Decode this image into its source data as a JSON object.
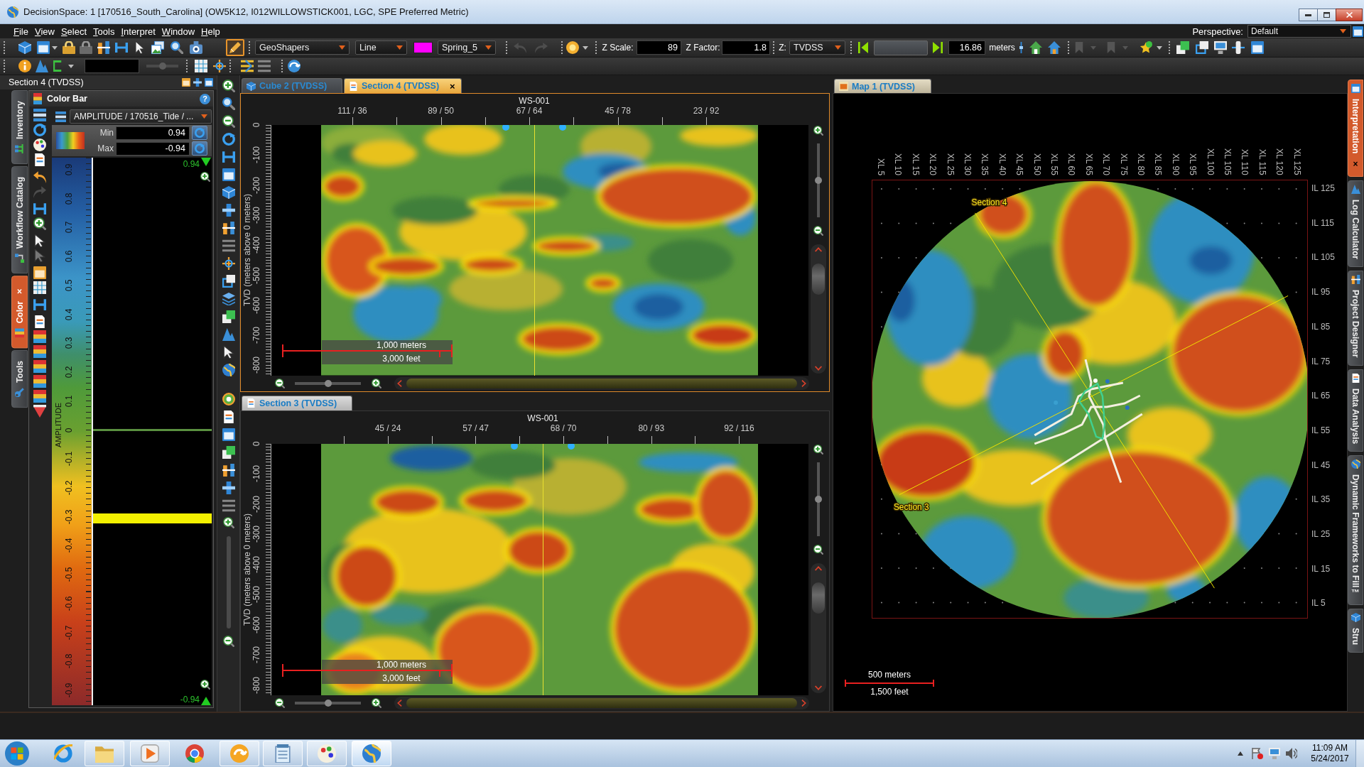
{
  "window": {
    "title": "DecisionSpace: 1 [170516_South_Carolina] (OW5K12, I012WILLOWSTICK001, LGC, SPE Preferred Metric)"
  },
  "menu": [
    "File",
    "View",
    "Select",
    "Tools",
    "Interpret",
    "Window",
    "Help"
  ],
  "perspective": {
    "label": "Perspective:",
    "value": "Default"
  },
  "toolbar": {
    "draw_mode_on": true,
    "shape_set": "GeoShapers",
    "shape_style": "Line",
    "color_map": "Spring_5",
    "undo_disabled": true,
    "redo_disabled": true,
    "z_scale_label": "Z Scale:",
    "z_scale": "89",
    "z_factor_label": "Z Factor:",
    "z_factor": "1.8",
    "z_label": "Z:",
    "z_domain": "TVDSS",
    "step": "16.86",
    "step_unit": "meters",
    "bookmarks_disabled": true
  },
  "toolbar_2": {
    "slider": {
      "level": 0.5,
      "disabled": true
    }
  },
  "left_panel": {
    "title": "Section 4 (TVDSS)",
    "tabs": [
      {
        "label": "Inventory",
        "selected": false
      },
      {
        "label": "Workflow Catalog",
        "selected": false
      },
      {
        "label": "Color",
        "selected": true,
        "close": "×"
      },
      {
        "label": "Tools",
        "selected": false
      }
    ],
    "color_bar": {
      "title": "Color Bar",
      "help": "?",
      "attribute": "AMPLITUDE / 170516_Tide / ...",
      "min_label": "Min",
      "min": "0.94",
      "max_label": "Max",
      "max": "-0.94",
      "axis_label": "AMPLITUDE",
      "ticks": [
        "0.9",
        "0.8",
        "0.7",
        "0.6",
        "0.5",
        "0.4",
        "0.3",
        "0.2",
        "0.1",
        "0",
        "-0.1",
        "-0.2",
        "-0.3",
        "-0.4",
        "-0.5",
        "-0.6",
        "-0.7",
        "-0.8",
        "-0.9"
      ],
      "top_value": "0.94",
      "bottom_value": "-0.94"
    }
  },
  "sections": [
    {
      "tabs": [
        {
          "label": "Cube 2 (TVDSS)",
          "kind": "cube",
          "selected": false
        },
        {
          "label": "Section 4 (TVDSS)",
          "kind": "section",
          "selected": true,
          "close": "×"
        }
      ],
      "active": true,
      "well_label": "WS-001",
      "x_labels": [
        "111 / 36",
        "89 / 50",
        "67 / 64",
        "45 / 78",
        "23 / 92"
      ],
      "y_title": "TVD (meters above 0 meters)",
      "y_labels": [
        "0",
        "-100",
        "-200",
        "-300",
        "-400",
        "-500",
        "-600",
        "-700",
        "-800"
      ],
      "scale": [
        "1,000 meters",
        "3,000 feet"
      ],
      "zoom": {
        "level": 0.5
      },
      "vertical_zoom": {
        "level": 0.5
      }
    },
    {
      "tabs": [
        {
          "label": "Section 3 (TVDSS)",
          "kind": "section",
          "selected": true
        }
      ],
      "active": false,
      "well_label": "WS-001",
      "x_labels": [
        "45 / 24",
        "57 / 47",
        "68 / 70",
        "80 / 93",
        "92 / 116"
      ],
      "y_title": "TVD (meters above 0 meters)",
      "y_labels": [
        "0",
        "-100",
        "-200",
        "-300",
        "-400",
        "-500",
        "-600",
        "-700",
        "-800"
      ],
      "scale": [
        "1,000 meters",
        "3,000 feet"
      ],
      "zoom": {
        "level": 0.5
      },
      "vertical_zoom": {
        "level": 0.5
      }
    }
  ],
  "map": {
    "tab": {
      "label": "Map 1 (TVDSS)",
      "selected": true
    },
    "xl_labels": [
      "XL 5",
      "XL 10",
      "XL 15",
      "XL 20",
      "XL 25",
      "XL 30",
      "XL 35",
      "XL 40",
      "XL 45",
      "XL 50",
      "XL 55",
      "XL 60",
      "XL 65",
      "XL 70",
      "XL 75",
      "XL 80",
      "XL 85",
      "XL 90",
      "XL 95",
      "XL 100",
      "XL 105",
      "XL 110",
      "XL 115",
      "XL 120",
      "XL 125"
    ],
    "il_labels": [
      "IL 125",
      "IL 115",
      "IL 105",
      "IL 95",
      "IL 85",
      "IL 75",
      "IL 65",
      "IL 55",
      "IL 45",
      "IL 35",
      "IL 25",
      "IL 15",
      "IL 5"
    ],
    "section_labels": [
      "Section 4",
      "Section 3"
    ],
    "scale": [
      "500 meters",
      "1,500 feet"
    ]
  },
  "right_tabs": [
    {
      "label": "Interpretation",
      "selected": true,
      "close": "×"
    },
    {
      "label": "Log Calculator",
      "selected": false
    },
    {
      "label": "Project Designer",
      "selected": false
    },
    {
      "label": "Data Analysis",
      "selected": false
    },
    {
      "label": "Dynamic Frameworks to Fill™",
      "selected": false
    },
    {
      "label": "Stru",
      "selected": false
    }
  ],
  "taskbar": {
    "apps": [
      {
        "kind": "ring",
        "running": false,
        "selected": false
      },
      {
        "kind": "folder",
        "running": true,
        "selected": false
      },
      {
        "kind": "media",
        "running": true,
        "selected": false
      },
      {
        "kind": "ball",
        "running": false,
        "selected": false
      },
      {
        "kind": "sync",
        "running": true,
        "selected": false
      },
      {
        "kind": "notepad",
        "running": true,
        "selected": false
      },
      {
        "kind": "paint",
        "running": true,
        "selected": false
      },
      {
        "kind": "globe",
        "running": true,
        "selected": true
      }
    ],
    "time": "11:09 AM",
    "date": "5/24/2017"
  }
}
